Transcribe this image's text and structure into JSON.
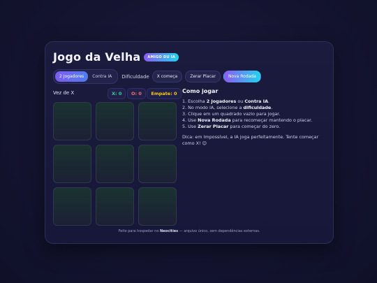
{
  "header": {
    "title": "Jogo da Velha",
    "badge": "AMIGO DU IA"
  },
  "controls": {
    "mode_two_players": "2 Jogadores",
    "mode_vs_ai": "Contra IA",
    "difficulty_label": "Dificuldade",
    "x_starts": "X começa",
    "reset_score": "Zerar Placar",
    "new_round": "Nova Rodada"
  },
  "status": {
    "turn": "Vez de X",
    "score_x": "X: 0",
    "score_o": "O: 0",
    "score_draw": "Empate: 0"
  },
  "board": [
    "",
    "",
    "",
    "",
    "",
    "",
    "",
    "",
    ""
  ],
  "help": {
    "title": "Como jogar",
    "steps": [
      [
        "1. Escolha ",
        "2 Jogadores",
        " ou ",
        "Contra IA",
        "."
      ],
      [
        "2. No modo IA, selecione a ",
        "dificuldade",
        "."
      ],
      [
        "3. Clique em um quadrado vazio para jogar."
      ],
      [
        "4. Use ",
        "Nova Rodada",
        " para recomeçar mantendo o placar."
      ],
      [
        "5. Use ",
        "Zerar Placar",
        " para começar do zero."
      ]
    ],
    "tip": "Dica: em Impossível, a IA joga perfeitamente. Tente começar como X! 😉"
  },
  "footer": {
    "pre": "Feito para hospedar no ",
    "brand": "Neocities",
    "post": " — arquivo único, sem dependências externas."
  }
}
